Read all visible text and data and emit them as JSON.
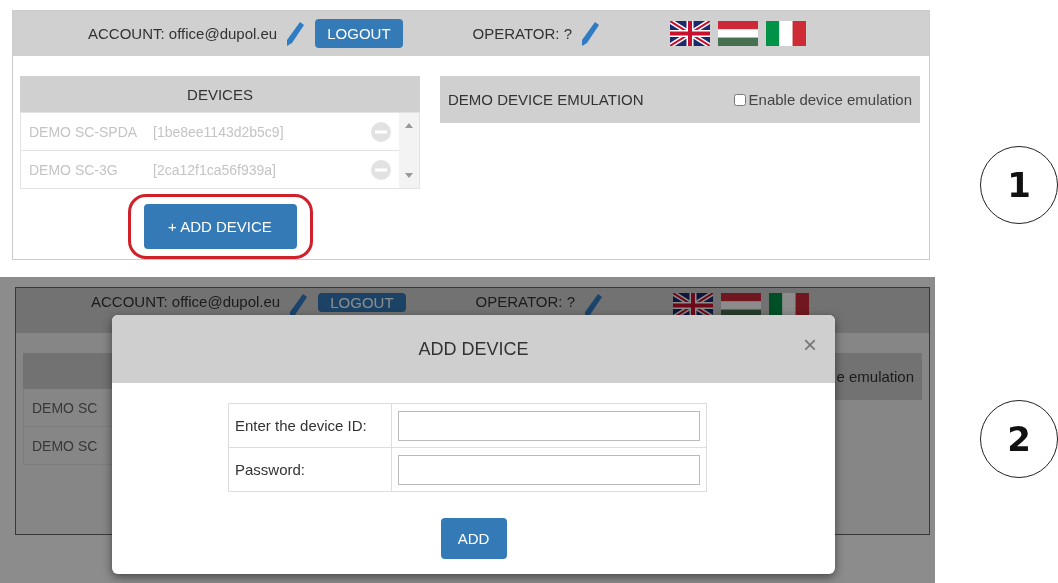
{
  "screen_1": {
    "header": {
      "account": "ACCOUNT: office@dupol.eu",
      "logout": "LOGOUT",
      "operator": "OPERATOR: ?",
      "flags": [
        {
          "kind": "uk"
        },
        {
          "kind": "hu"
        },
        {
          "kind": "it"
        }
      ]
    },
    "devices": {
      "title": "DEVICES",
      "rows": [
        {
          "name": "DEMO SC-SPDA",
          "id": "[1be8ee1143d2b5c9]"
        },
        {
          "name": "DEMO SC-3G",
          "id": "[2ca12f1ca56f939a]"
        }
      ],
      "add_button": "+ ADD DEVICE",
      "highlighted": true
    },
    "emulation": {
      "title": "DEMO DEVICE EMULATION",
      "checkbox_label": "Enable device emulation",
      "checked": false
    }
  },
  "screen_2": {
    "background": {
      "header": {
        "account": "ACCOUNT: office@dupol.eu",
        "logout": "LOGOUT",
        "operator": "OPERATOR: ?",
        "flags": [
          {
            "kind": "uk"
          },
          {
            "kind": "hu"
          },
          {
            "kind": "it"
          }
        ]
      },
      "device_rows": [
        "DEMO SC",
        "DEMO SC"
      ],
      "emulation_fragment": "e emulation"
    },
    "dialog": {
      "title": "ADD DEVICE",
      "close": "×",
      "fields": [
        {
          "label": "Enter the device ID:"
        },
        {
          "label": "Password:"
        }
      ],
      "button": "ADD"
    }
  },
  "step_markers": [
    "1",
    "2"
  ]
}
